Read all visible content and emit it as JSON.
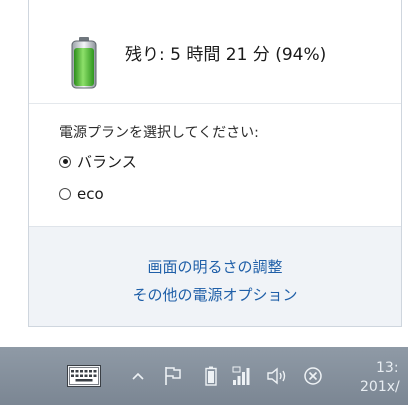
{
  "battery": {
    "status_text": "残り: 5 時間 21 分 (94%)",
    "percent": 94,
    "icon": "battery-icon",
    "fill_color": "#3fae29"
  },
  "power_plans": {
    "heading": "電源プランを選択してください:",
    "options": [
      {
        "label": "バランス",
        "selected": true
      },
      {
        "label": "eco",
        "selected": false
      }
    ]
  },
  "links": {
    "brightness": "画面の明るさの調整",
    "more_options": "その他の電源オプション"
  },
  "taskbar": {
    "icons": [
      "keyboard-icon",
      "show-hidden-icons-chevron-icon",
      "action-center-flag-icon",
      "battery-icon",
      "network-signal-icon",
      "volume-icon",
      "close-circle-icon"
    ],
    "clock_time": "13:",
    "clock_date": "201x/"
  },
  "colors": {
    "link": "#1f5fa8",
    "taskbar": "#7f8a97",
    "links_background": "#f0f3f7"
  }
}
